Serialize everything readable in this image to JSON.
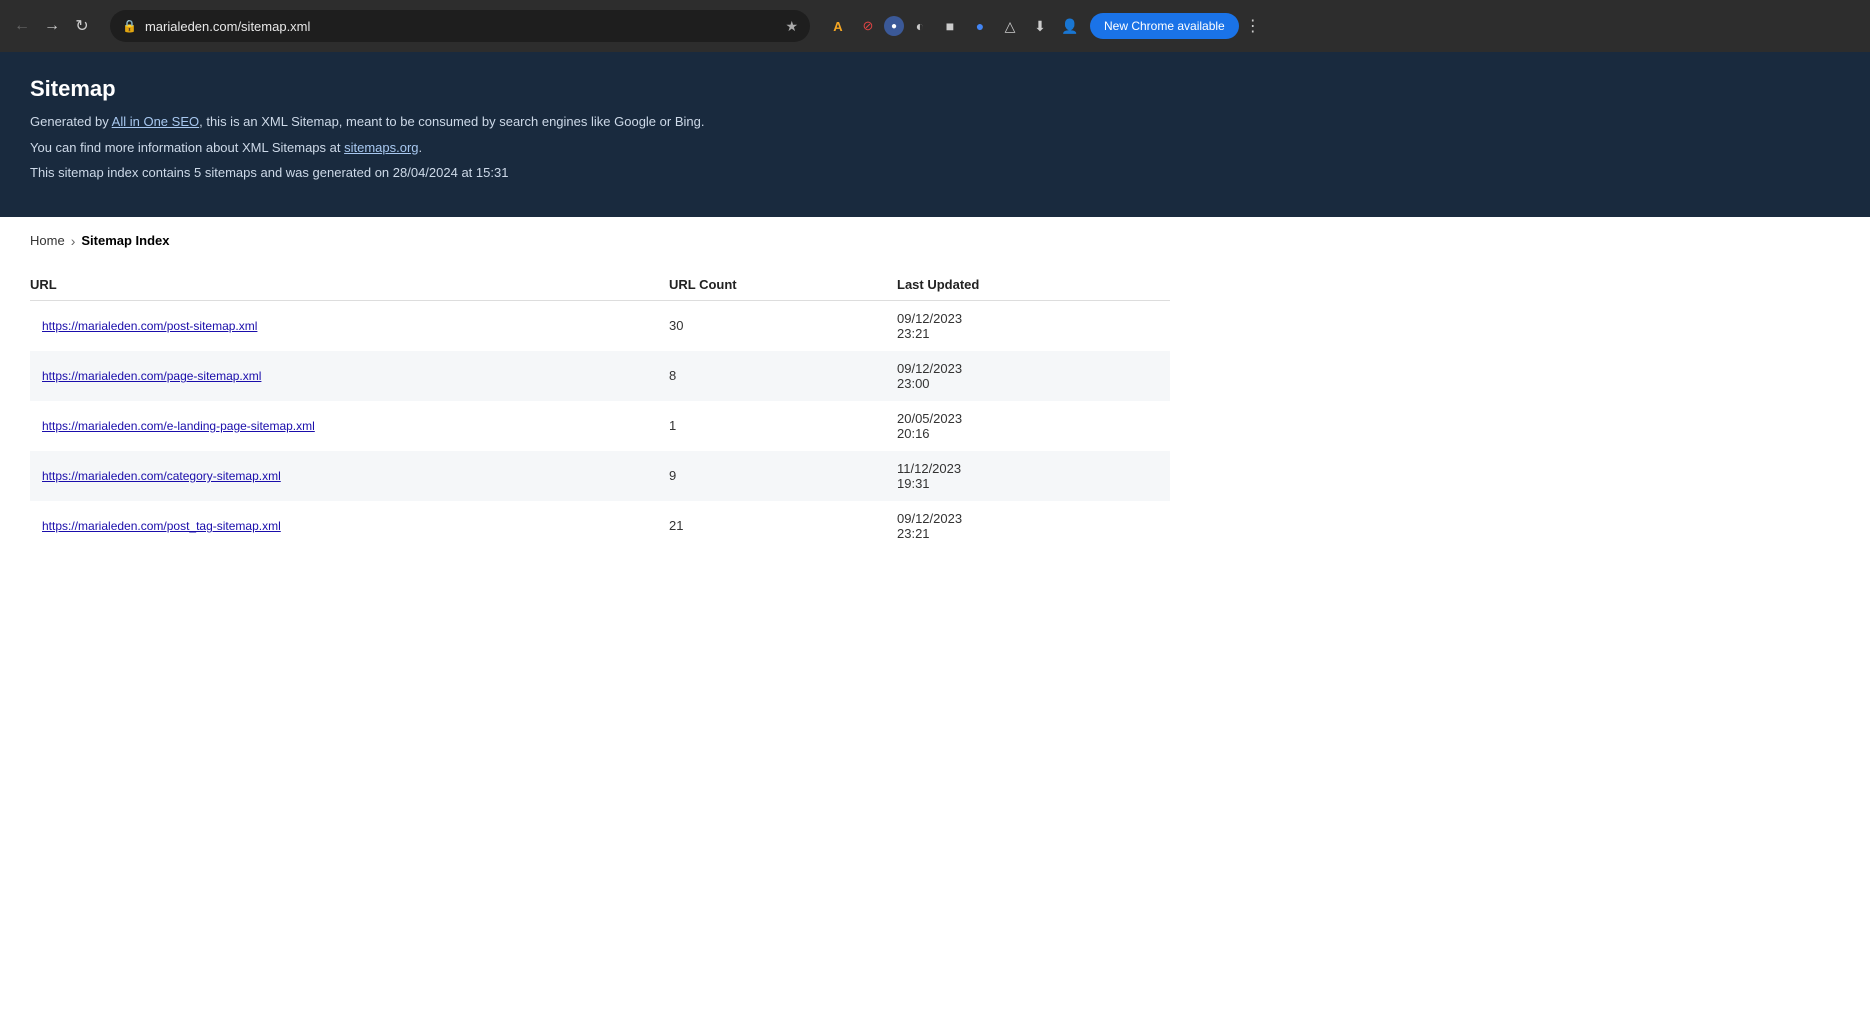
{
  "browser": {
    "url": "marialeden.com/sitemap.xml",
    "new_chrome_label": "New Chrome available"
  },
  "page_header": {
    "title": "Sitemap",
    "line1_prefix": "Generated by ",
    "line1_link_text": "All in One SEO",
    "line1_suffix": ", this is an XML Sitemap, meant to be consumed by search engines like Google or Bing.",
    "line2_prefix": "You can find more information about XML Sitemaps at ",
    "line2_link_text": "sitemaps.org",
    "line2_suffix": ".",
    "line3": "This sitemap index contains 5 sitemaps and was generated on 28/04/2024 at 15:31"
  },
  "breadcrumb": {
    "home_label": "Home",
    "current_label": "Sitemap Index"
  },
  "table": {
    "headers": [
      "URL",
      "URL Count",
      "Last Updated"
    ],
    "rows": [
      {
        "url": "https://marialeden.com/post-sitemap.xml",
        "count": "30",
        "updated": "09/12/2023\n23:21"
      },
      {
        "url": "https://marialeden.com/page-sitemap.xml",
        "count": "8",
        "updated": "09/12/2023\n23:00"
      },
      {
        "url": "https://marialeden.com/e-landing-page-sitemap.xml",
        "count": "1",
        "updated": "20/05/2023\n20:16"
      },
      {
        "url": "https://marialeden.com/category-sitemap.xml",
        "count": "9",
        "updated": "11/12/2023\n19:31"
      },
      {
        "url": "https://marialeden.com/post_tag-sitemap.xml",
        "count": "21",
        "updated": "09/12/2023\n23:21"
      }
    ]
  }
}
